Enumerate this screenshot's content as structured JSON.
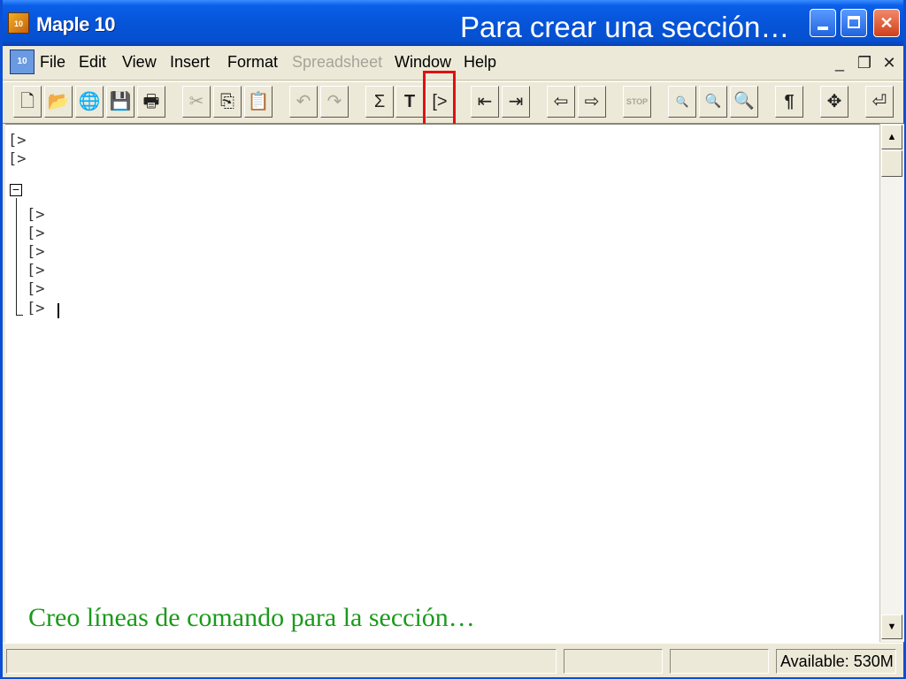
{
  "window": {
    "app_title": "Maple 10",
    "app_icon_text": "10",
    "slide_caption": "Para crear una sección…"
  },
  "menu": {
    "doc_icon_text": "10",
    "items": [
      {
        "label": "File",
        "enabled": true
      },
      {
        "label": "Edit",
        "enabled": true
      },
      {
        "label": "View",
        "enabled": true
      },
      {
        "label": "Insert",
        "enabled": true
      },
      {
        "label": "Format",
        "enabled": true
      },
      {
        "label": "Spreadsheet",
        "enabled": false
      },
      {
        "label": "Window",
        "enabled": true
      },
      {
        "label": "Help",
        "enabled": true
      }
    ]
  },
  "toolbar": {
    "buttons": [
      {
        "name": "new-document",
        "glyph": "🗋"
      },
      {
        "name": "open",
        "glyph": "📂"
      },
      {
        "name": "open-url",
        "glyph": "🌐"
      },
      {
        "name": "save",
        "glyph": "💾"
      },
      {
        "name": "print",
        "glyph": "🖶"
      },
      {
        "name": "cut",
        "glyph": "✂"
      },
      {
        "name": "copy",
        "glyph": "⎘"
      },
      {
        "name": "paste",
        "glyph": "📋"
      },
      {
        "name": "undo",
        "glyph": "↶"
      },
      {
        "name": "redo",
        "glyph": "↷"
      },
      {
        "name": "insert-math",
        "glyph": "Σ"
      },
      {
        "name": "insert-text",
        "glyph": "T"
      },
      {
        "name": "insert-execution-group",
        "glyph": "[>"
      },
      {
        "name": "outdent-section",
        "glyph": "⇤"
      },
      {
        "name": "indent-section",
        "glyph": "⇥"
      },
      {
        "name": "back",
        "glyph": "⇦"
      },
      {
        "name": "forward",
        "glyph": "⇨"
      },
      {
        "name": "stop",
        "glyph": "STOP"
      },
      {
        "name": "zoom-small",
        "glyph": "🔍"
      },
      {
        "name": "zoom-medium",
        "glyph": "🔍"
      },
      {
        "name": "zoom-large",
        "glyph": "🔍"
      },
      {
        "name": "show-paragraph",
        "glyph": "¶"
      },
      {
        "name": "expand-sections",
        "glyph": "✥"
      },
      {
        "name": "restart",
        "glyph": "⏎"
      }
    ]
  },
  "worksheet": {
    "prompt_symbol": "[>",
    "prompt_count_top": 2,
    "prompt_count_section": 6,
    "section_toggle": "−",
    "annotation": "Creo líneas de comando para la sección…"
  },
  "statusbar": {
    "memory": "Available: 530M"
  }
}
